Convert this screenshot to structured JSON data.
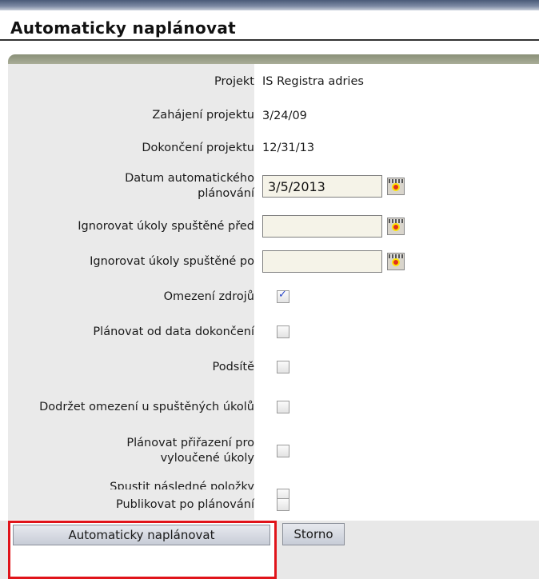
{
  "dialog": {
    "title": "Automaticky naplánovat"
  },
  "fields": {
    "project": {
      "label": "Projekt",
      "value": "IS Registra adries"
    },
    "start": {
      "label": "Zahájení projektu",
      "value": "3/24/09"
    },
    "finish": {
      "label": "Dokončení projektu",
      "value": "12/31/13"
    },
    "schedule_date": {
      "label": "Datum automatického plánování",
      "value": "3/5/2013"
    },
    "ignore_before": {
      "label": "Ignorovat úkoly spuštěné před",
      "value": ""
    },
    "ignore_after": {
      "label": "Ignorovat úkoly spuštěné po",
      "value": ""
    }
  },
  "options": [
    {
      "label": "Omezení zdrojů",
      "checked": true
    },
    {
      "label": "Plánovat od data dokončení",
      "checked": false
    },
    {
      "label": "Podsítě",
      "checked": false
    },
    {
      "label": "Dodržet omezení u spuštěných úkolů",
      "checked": false
    },
    {
      "label": "Plánovat přiřazení pro vyloučené úkoly",
      "checked": false
    },
    {
      "label": "Spustit následné položky následující den",
      "checked": false
    },
    {
      "label": "Publikovat po plánování",
      "checked": false
    }
  ],
  "buttons": {
    "schedule": "Automaticky naplánovat",
    "cancel": "Storno"
  }
}
